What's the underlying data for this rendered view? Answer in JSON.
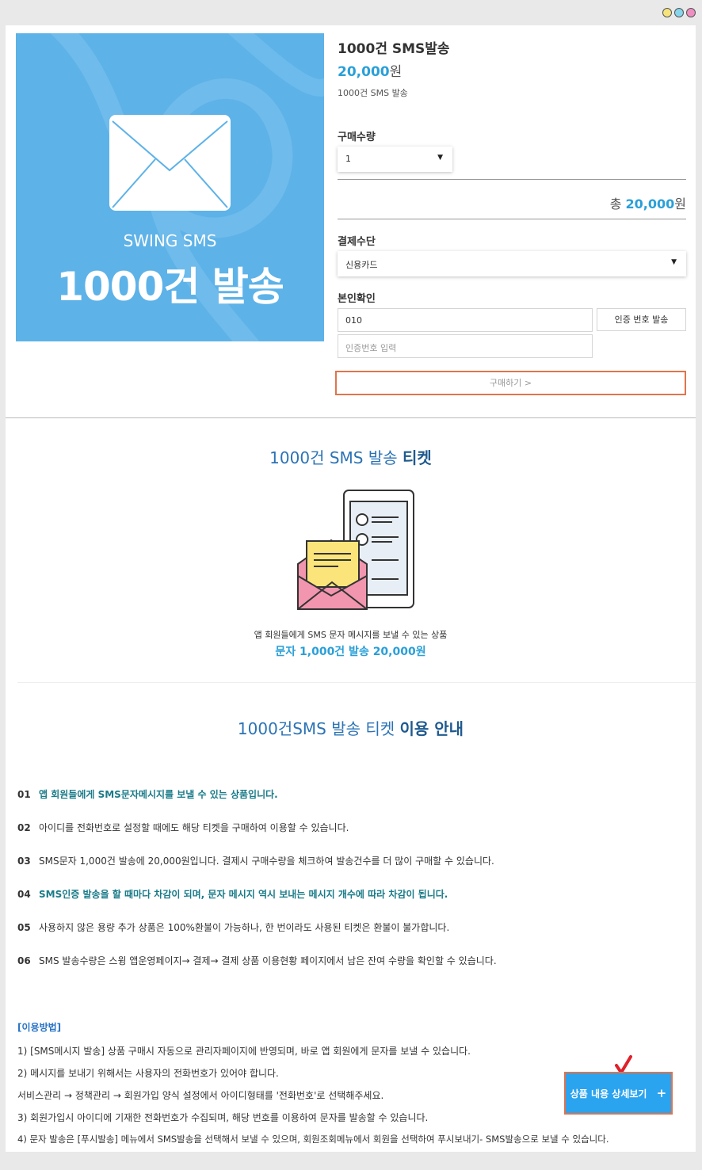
{
  "product": {
    "hero_subtitle": "SWING SMS",
    "hero_title": "1000건 발송",
    "title": "1000건 SMS발송",
    "price_number": "20,000",
    "price_unit": "원",
    "description": "1000건 SMS 발송"
  },
  "order": {
    "quantity_label": "구매수량",
    "quantity_value": "1",
    "total_prefix": "총 ",
    "total_number": "20,000",
    "total_unit": "원",
    "payment_label": "결제수단",
    "payment_value": "신용카드",
    "verify_label": "본인확인",
    "phone_value": "010",
    "send_code_label": "인증 번호 발송",
    "code_placeholder": "인증번호 입력",
    "buy_label": "구매하기 >"
  },
  "ticket": {
    "title_prefix": "1000건 SMS 발송 ",
    "title_bold": "티켓",
    "desc": "앱 회원들에게 SMS 문자 메시지를 보낼 수 있는 상품",
    "price_line": "문자 1,000건 발송 20,000원"
  },
  "guide": {
    "title_prefix": "1000건SMS 발송 티켓 ",
    "title_bold": "이용 안내",
    "notes": [
      {
        "no": "01",
        "text": "앱 회원들에게 SMS문자메시지를 보낼 수 있는 상품입니다."
      },
      {
        "no": "02",
        "text": "아이디를 전화번호로 설정할 때에도 해당 티켓을 구매하여 이용할 수 있습니다."
      },
      {
        "no": "03",
        "text": "SMS문자 1,000건 발송에 20,000원입니다. 결제시 구매수량을 체크하여 발송건수를 더 많이 구매할 수 있습니다."
      },
      {
        "no": "04",
        "text": "SMS인증 발송을 할 때마다 차감이 되며, 문자 메시지 역시 보내는 메시지 개수에 따라 차감이 됩니다."
      },
      {
        "no": "05",
        "text": "사용하지 않은 용량 추가 상품은 100%환불이 가능하나, 한 번이라도 사용된 티켓은 환불이 불가합니다."
      },
      {
        "no": "06",
        "text": "SMS 발송수량은 스윙 앱운영페이지→ 결제→ 결제 상품 이용현황 페이지에서 남은 잔여 수량을 확인할 수 있습니다."
      }
    ]
  },
  "howto": {
    "title": "[이용방법]",
    "lines": [
      "1) [SMS메시지 발송] 상품 구매시 자동으로 관리자페이지에 반영되며, 바로 앱 회원에게 문자를 보낼 수 있습니다.",
      "2) 메시지를 보내기 위해서는 사용자의 전화번호가 있어야 합니다.",
      "서비스관리 → 정책관리 → 회원가입 양식 설정에서 아이디형태를 '전화번호'로 선택해주세요.",
      "3) 회원가입시 아이디에 기재한 전화번호가 수집되며, 해당 번호를 이용하여 문자를 발송할 수 있습니다.",
      "4) 문자 발송은 [푸시발송] 메뉴에서 SMS발송을 선택해서 보낼 수 있으며, 회원조회메뉴에서 회원을 선택하여 푸시보내기- SMS발송으로 보낼 수 있습니다."
    ]
  },
  "detail_button": {
    "label": "상품 내용 상세보기",
    "plus": "+"
  },
  "colors": {
    "accent": "#2a9fd8",
    "hero": "#5db2e8",
    "highlight_border": "#e0744c",
    "detail_button": "#2ba4f0",
    "title_blue": "#2b73b5",
    "note_highlight": "#1a7b88"
  },
  "icons": {
    "window_controls": [
      "yellow-dot-icon",
      "cyan-dot-icon",
      "pink-dot-icon"
    ],
    "check": "red-check-icon",
    "dropdown": "caret-down-icon"
  }
}
